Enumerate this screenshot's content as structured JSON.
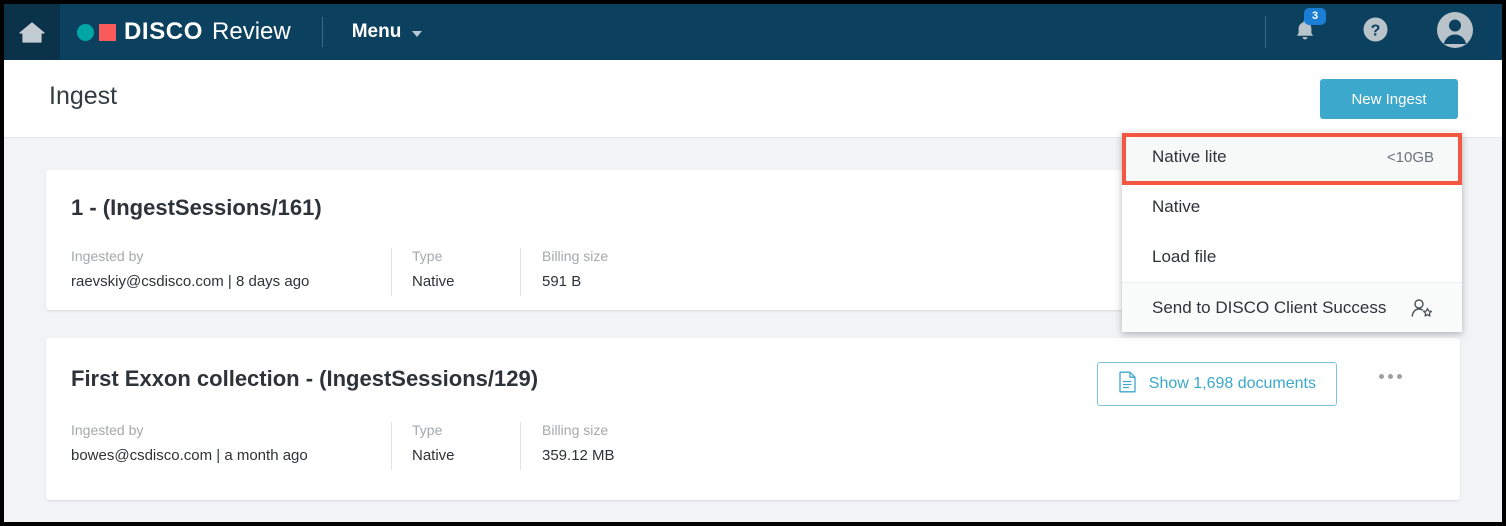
{
  "topbar": {
    "home_icon": "home-icon",
    "brand_disco": "DISCO",
    "brand_review": "Review",
    "menu_label": "Menu",
    "caret_icon": "chevron-down-icon",
    "bell_icon": "bell-icon",
    "notification_count": "3",
    "help_icon": "help-circle-icon",
    "avatar_icon": "user-avatar-icon",
    "colors": {
      "bar_background": "#0c405f",
      "home_block": "#0a3248",
      "logo_dot": "#00a6a6",
      "logo_square": "#fb5a5a",
      "badge": "#1a7fd4"
    }
  },
  "page_header": {
    "title": "Ingest",
    "new_ingest_label": "New Ingest",
    "new_ingest_color": "#3ca8cb"
  },
  "cards": [
    {
      "title": "1 - (IngestSessions/161)",
      "meta": [
        {
          "label": "Ingested by",
          "value": "raevskiy@csdisco.com | 8 days ago"
        },
        {
          "label": "Type",
          "value": "Native"
        },
        {
          "label": "Billing size",
          "value": "591 B"
        }
      ],
      "show_documents_label": "",
      "has_actions": false
    },
    {
      "title": "First Exxon collection - (IngestSessions/129)",
      "meta": [
        {
          "label": "Ingested by",
          "value": "bowes@csdisco.com | a month ago"
        },
        {
          "label": "Type",
          "value": "Native"
        },
        {
          "label": "Billing size",
          "value": "359.12 MB"
        }
      ],
      "show_documents_label": "Show 1,698 documents",
      "document_icon": "document-icon",
      "kebab_icon": "more-options-icon",
      "has_actions": true
    }
  ],
  "dropdown": {
    "items": [
      {
        "label": "Native lite",
        "hint": "<10GB",
        "highlighted": true
      },
      {
        "label": "Native",
        "hint": "",
        "highlighted": false
      },
      {
        "label": "Load file",
        "hint": "",
        "highlighted": false
      },
      {
        "label": "Send to DISCO Client Success",
        "hint": "",
        "icon": "person-star-icon",
        "separated": true
      }
    ],
    "highlight_color": "#f4573f"
  }
}
